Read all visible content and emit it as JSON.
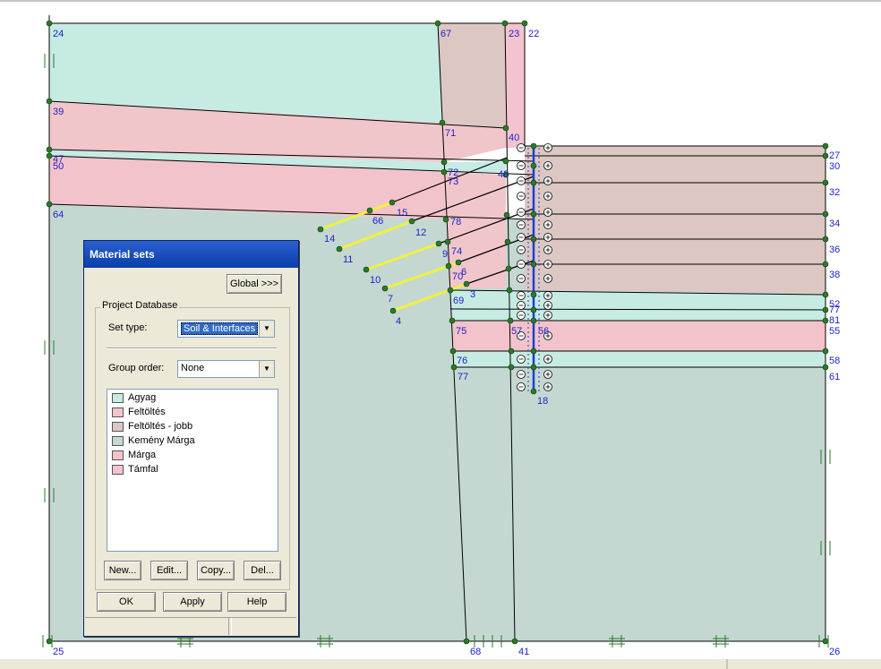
{
  "colors": {
    "agyag": "#c6ebe2",
    "feltoltes": "#f0c6cb",
    "feltoltes_jobb": "#dcc7c3",
    "kemeny_marga": "#c4d8d1",
    "marga": "#f2c3ca",
    "tamfal": "#f4c3d0",
    "point_label": "#1f1fc8",
    "node": "#2a7a2a",
    "anchor_grout": "#f0f040",
    "wall": "#1f3fcf"
  },
  "geometry_labels": {
    "p24": "24",
    "p67": "67",
    "p23": "23",
    "p22": "22",
    "p39": "39",
    "p71": "71",
    "p40": "40",
    "p47": "47",
    "p50": "50",
    "p27": "27",
    "p30": "30",
    "p72": "72",
    "p73": "73",
    "p48": "48",
    "p32": "32",
    "p64": "64",
    "p15": "15",
    "p66": "66",
    "p78": "78",
    "p34": "34",
    "p14": "14",
    "p12": "12",
    "p9": "9",
    "p74": "74",
    "p11": "11",
    "p36": "36",
    "p38": "38",
    "p10": "10",
    "p6": "6",
    "p70": "70",
    "p3": "3",
    "p7": "7",
    "p69": "69",
    "p4": "4",
    "p52": "52",
    "p77": "77",
    "p81": "81",
    "p75": "75",
    "p57": "57",
    "p55": "55",
    "p56": "56",
    "p76": "76",
    "p58": "58",
    "p61": "61",
    "p18": "18",
    "p25": "25",
    "p68": "68",
    "p41": "41",
    "p26": "26"
  },
  "dialog": {
    "title": "Material sets",
    "global_button": "Global >>>",
    "group_title": "Project Database",
    "set_type_label": "Set type:",
    "set_type_value": "Soil & Interfaces",
    "group_order_label": "Group order:",
    "group_order_value": "None",
    "materials": [
      {
        "name": "Agyag",
        "color": "#c6ebe2"
      },
      {
        "name": "Feltöltés",
        "color": "#f0c6cb"
      },
      {
        "name": "Feltöltés - jobb",
        "color": "#dcc7c3"
      },
      {
        "name": "Kemény Márga",
        "color": "#c4d8d1"
      },
      {
        "name": "Márga",
        "color": "#f2c3ca"
      },
      {
        "name": "Támfal",
        "color": "#f4c3d0"
      }
    ],
    "buttons": {
      "new": "New...",
      "edit": "Edit...",
      "copy": "Copy...",
      "delete": "Del...",
      "ok": "OK",
      "apply": "Apply",
      "help": "Help"
    }
  }
}
